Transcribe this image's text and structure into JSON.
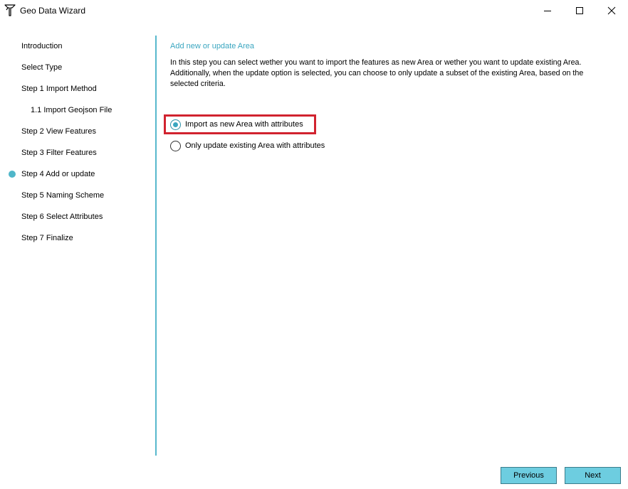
{
  "window": {
    "title": "Geo Data Wizard",
    "icon": "wizard-app-icon",
    "controls": [
      "minimize-icon",
      "maximize-icon",
      "close-icon"
    ]
  },
  "sidebar": {
    "items": [
      {
        "label": "Introduction",
        "active": false,
        "sub": false
      },
      {
        "label": "Select Type",
        "active": false,
        "sub": false
      },
      {
        "label": "Step 1 Import Method",
        "active": false,
        "sub": false
      },
      {
        "label": "1.1 Import Geojson File",
        "active": false,
        "sub": true
      },
      {
        "label": "Step 2 View Features",
        "active": false,
        "sub": false
      },
      {
        "label": "Step 3 Filter Features",
        "active": false,
        "sub": false
      },
      {
        "label": "Step 4 Add or update",
        "active": true,
        "sub": false
      },
      {
        "label": "Step 5 Naming Scheme",
        "active": false,
        "sub": false
      },
      {
        "label": "Step 6 Select Attributes",
        "active": false,
        "sub": false
      },
      {
        "label": "Step 7 Finalize",
        "active": false,
        "sub": false
      }
    ]
  },
  "content": {
    "heading": "Add new or update Area",
    "description": "In this step you can select wether you want to import the features as new Area or wether you want to update existing Area. Additionally, when the update option is selected, you can choose to only update a subset of the existing Area, based on the selected criteria.",
    "options": [
      {
        "label": "Import as new Area with attributes",
        "selected": true
      },
      {
        "label": "Only update existing Area with attributes",
        "selected": false
      }
    ]
  },
  "footer": {
    "previous_label": "Previous",
    "next_label": "Next"
  },
  "colors": {
    "accent": "#3aa6c0",
    "divider": "#58b8cd",
    "button": "#6dcde0",
    "highlight": "#d1232f"
  }
}
